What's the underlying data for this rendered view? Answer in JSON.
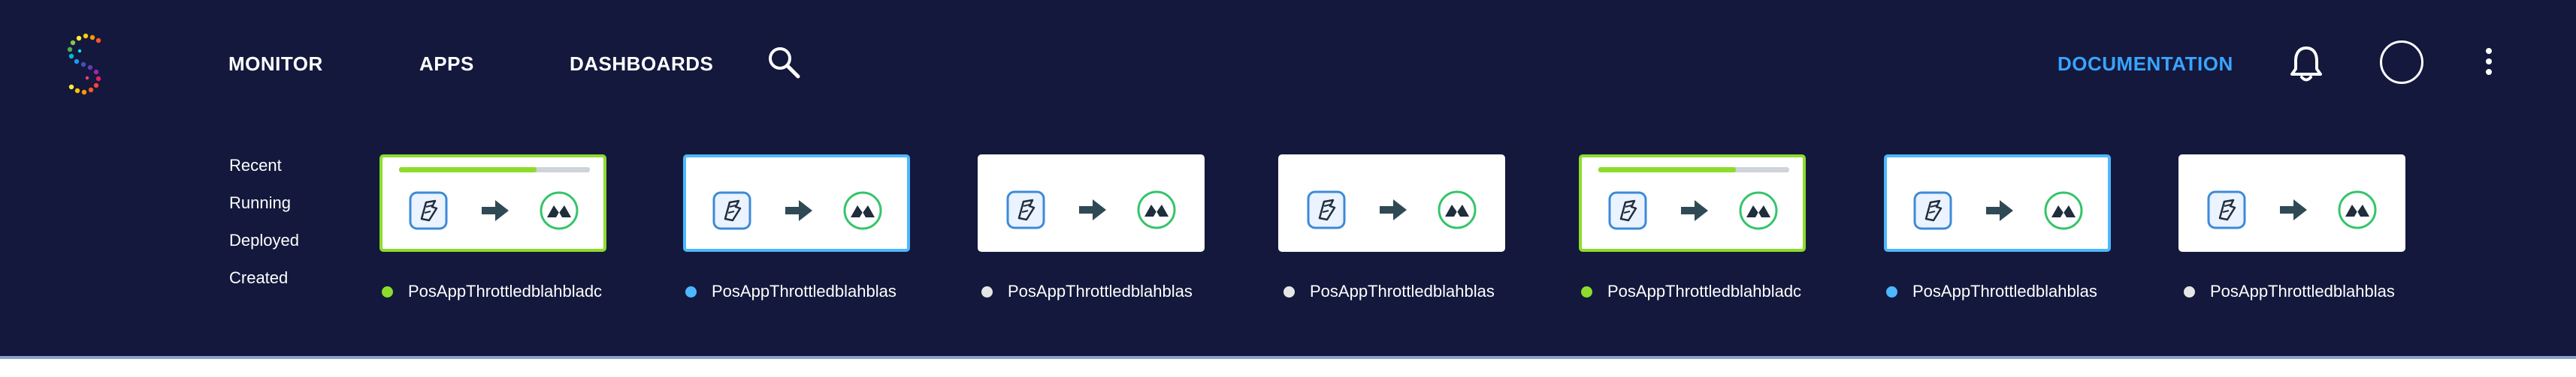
{
  "nav": {
    "items": [
      {
        "label": "MONITOR",
        "icon": "none"
      },
      {
        "label": "APPS",
        "icon": "none"
      },
      {
        "label": "DASHBOARDS",
        "icon": "none"
      }
    ],
    "search_icon": "search-icon",
    "documentation_label": "DOCUMENTATION",
    "notifications_icon": "bell-icon",
    "more_icon": "kebab-menu-icon"
  },
  "filters": [
    "Recent",
    "Running",
    "Deployed",
    "Created"
  ],
  "status_colors": {
    "running": "#8ddc2c",
    "deployed": "#4db8ff",
    "created": "#e6e6e6"
  },
  "apps": [
    {
      "name": "PosAppThrottledblahbladc",
      "status": "running",
      "progress": 0.72
    },
    {
      "name": "PosAppThrottledblahblas",
      "status": "deployed"
    },
    {
      "name": "PosAppThrottledblahblas",
      "status": "created"
    },
    {
      "name": "PosAppThrottledblahblas",
      "status": "created"
    },
    {
      "name": "PosAppThrottledblahbladc",
      "status": "running",
      "progress": 0.72
    },
    {
      "name": "PosAppThrottledblahblas",
      "status": "deployed"
    },
    {
      "name": "PosAppThrottledblahblas",
      "status": "created"
    }
  ]
}
